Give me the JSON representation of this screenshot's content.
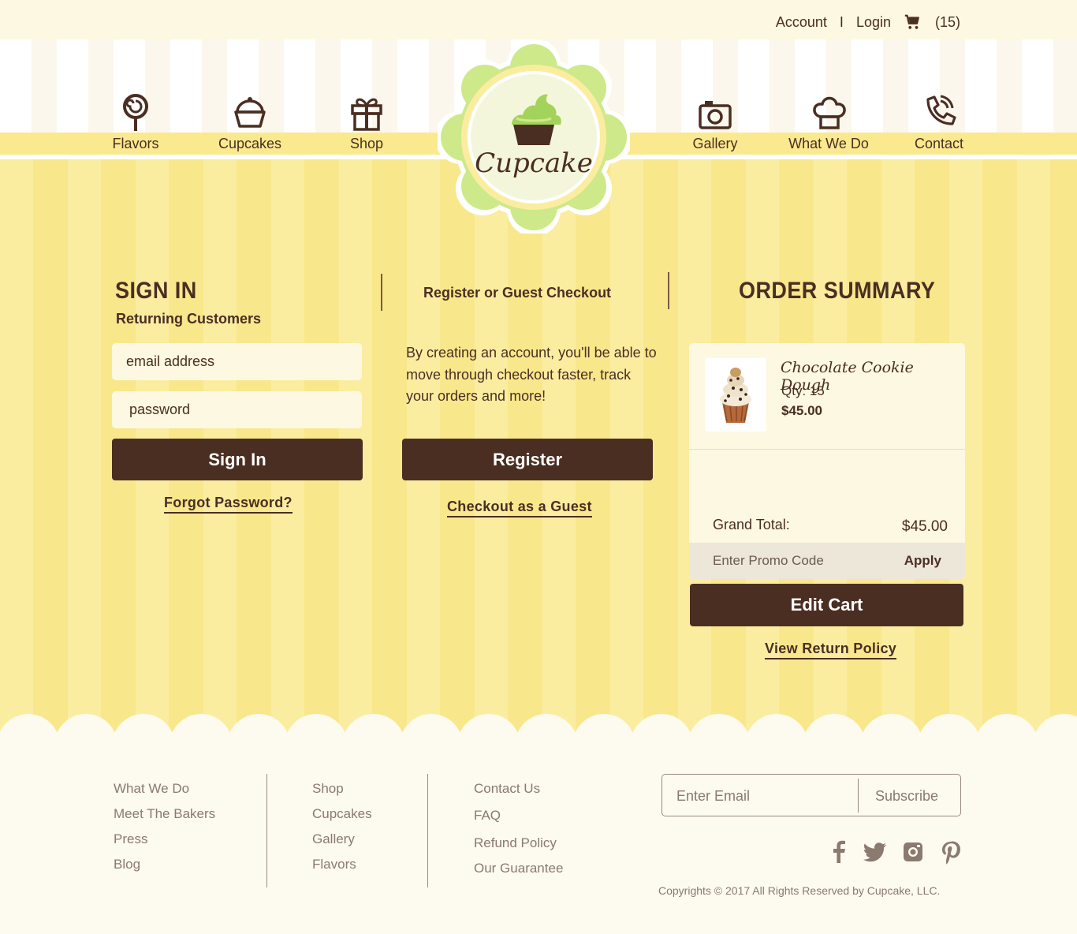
{
  "header": {
    "account": "Account",
    "separator": "I",
    "login": "Login",
    "cart_count": "(15)"
  },
  "nav": {
    "left": [
      {
        "label": "Flavors",
        "icon": "lollipop-icon"
      },
      {
        "label": "Cupcakes",
        "icon": "cupcake-icon"
      },
      {
        "label": "Shop",
        "icon": "gift-icon"
      }
    ],
    "right": [
      {
        "label": "Gallery",
        "icon": "camera-icon"
      },
      {
        "label": "What We Do",
        "icon": "chef-hat-icon"
      },
      {
        "label": "Contact",
        "icon": "phone-icon"
      }
    ]
  },
  "logo": {
    "text": "Cupcake"
  },
  "signin": {
    "title": "SIGN IN",
    "subtitle": "Returning Customers",
    "email_placeholder": "email address",
    "password_placeholder": "password",
    "button": "Sign In",
    "forgot": "Forgot Password?"
  },
  "register": {
    "title": "Register or Guest Checkout",
    "text": "By creating an account, you'll be able to move through checkout faster, track your orders and more!",
    "button": "Register",
    "guest": "Checkout as a Guest"
  },
  "order": {
    "title": "ORDER SUMMARY",
    "item": {
      "name": "Chocolate Cookie Dough",
      "qty": "Qty: 15",
      "price": "$45.00"
    },
    "grand_total_label": "Grand Total:",
    "grand_total_value": "$45.00",
    "promo_placeholder": "Enter Promo Code",
    "apply": "Apply",
    "edit_cart": "Edit Cart",
    "return_policy": "View Return Policy"
  },
  "footer": {
    "col1": [
      "What We Do",
      "Meet The Bakers",
      "Press",
      "Blog"
    ],
    "col2": [
      "Shop",
      "Cupcakes",
      "Gallery",
      "Flavors"
    ],
    "col3": [
      "Contact Us",
      "FAQ",
      "Refund Policy",
      "Our Guarantee"
    ],
    "email_placeholder": "Enter Email",
    "subscribe": "Subscribe",
    "social": [
      "facebook-icon",
      "twitter-icon",
      "instagram-icon",
      "pinterest-icon"
    ],
    "copyright": "Copyrights © 2017 All Rights Reserved by Cupcake, LLC."
  },
  "colors": {
    "brown": "#4a2e22",
    "yellow": "#fbe98f",
    "green": "#cde98a"
  }
}
